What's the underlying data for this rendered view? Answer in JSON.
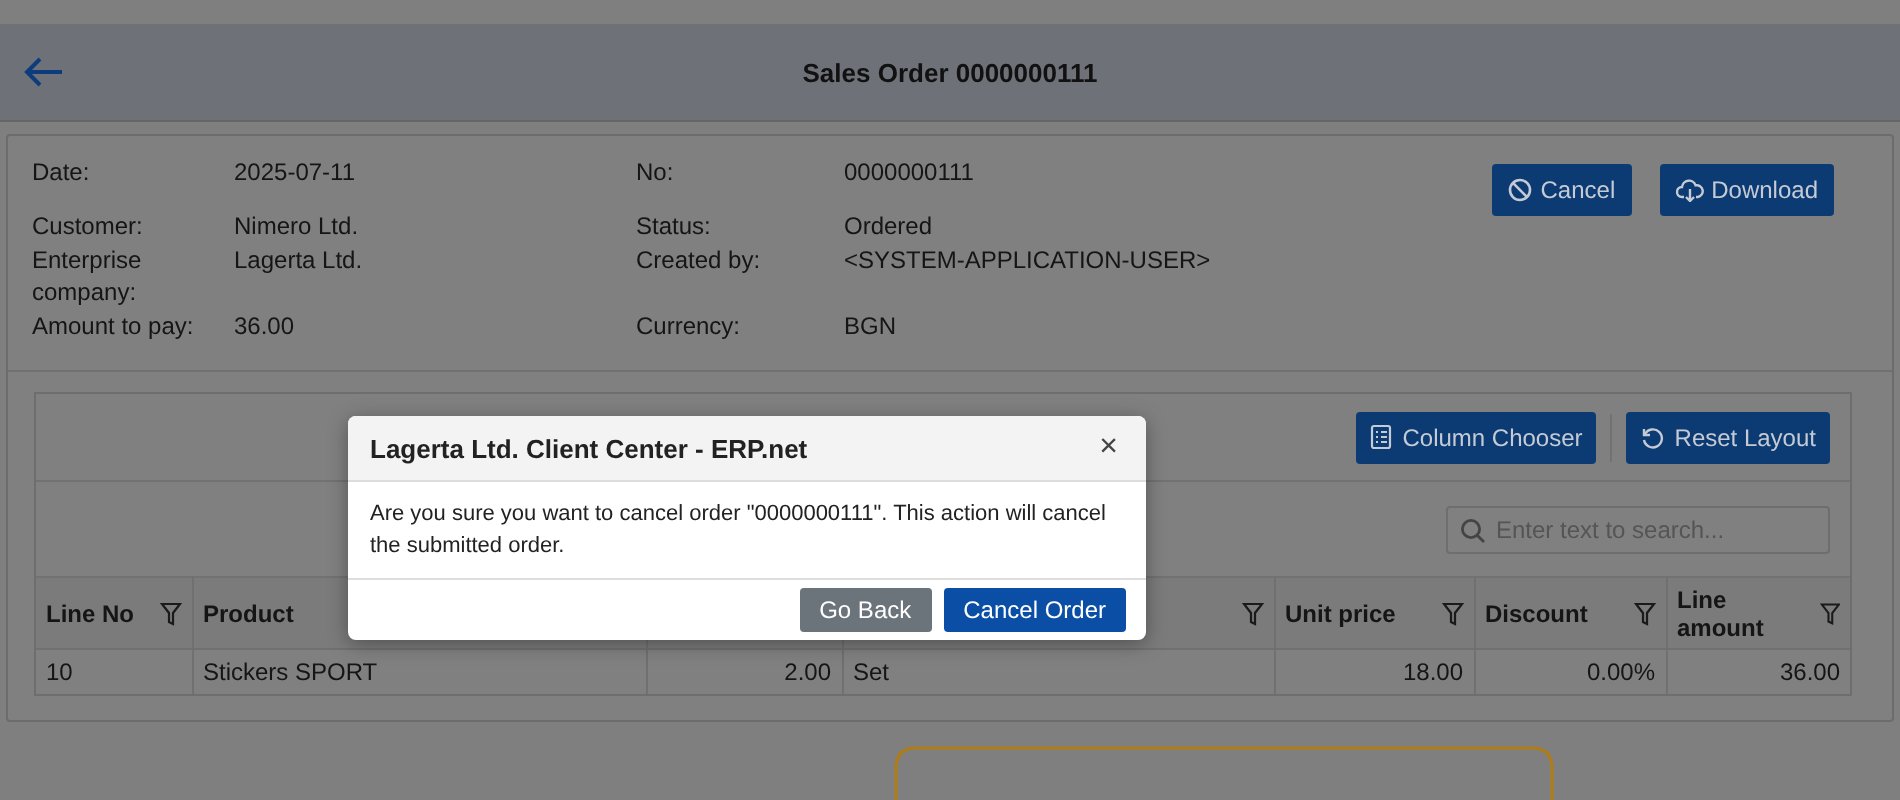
{
  "header": {
    "title": "Sales Order 0000000111"
  },
  "details": {
    "fields": [
      {
        "label": "Date:",
        "value": "2025-07-11"
      },
      {
        "label": "No:",
        "value": "0000000111"
      },
      {
        "label": "Customer:",
        "value": "Nimero Ltd."
      },
      {
        "label": "Status:",
        "value": "Ordered"
      },
      {
        "label": "Enterprise company:",
        "value": "Lagerta Ltd."
      },
      {
        "label": "Created by:",
        "value": "<SYSTEM-APPLICATION-USER>"
      },
      {
        "label": "Amount to pay:",
        "value": "36.00"
      },
      {
        "label": "Currency:",
        "value": "BGN"
      }
    ],
    "buttons": [
      {
        "kind": "cancel",
        "label": "Cancel"
      },
      {
        "kind": "download",
        "label": "Download"
      }
    ]
  },
  "grid": {
    "toolbar": [
      {
        "kind": "columns",
        "label": "Column Chooser"
      },
      {
        "kind": "reset",
        "label": "Reset Layout"
      }
    ],
    "search": {
      "placeholder": "Enter text to search..."
    },
    "columns": [
      {
        "label": "Line No",
        "filter": true,
        "numeric": false
      },
      {
        "label": "Product",
        "filter": false,
        "numeric": false
      },
      {
        "filter": false,
        "numeric": true
      },
      {
        "filter": true,
        "numeric": false
      },
      {
        "label": "Unit price",
        "filter": true,
        "numeric": true
      },
      {
        "label": "Discount",
        "filter": true,
        "numeric": true
      },
      {
        "label": "Line amount",
        "filter": true,
        "numeric": true
      }
    ],
    "rows": [
      [
        "10",
        "Stickers SPORT",
        "2.00",
        "Set",
        "18.00",
        "0.00%",
        "36.00"
      ]
    ]
  },
  "dialog": {
    "title": "Lagerta Ltd. Client Center - ERP.net",
    "close": "×",
    "message": "Are you sure you want to cancel order \"0000000111\". This action will cancel the submitted order.",
    "buttons": [
      {
        "kind": "secondary",
        "label": "Go Back"
      },
      {
        "kind": "primary",
        "label": "Cancel Order"
      }
    ]
  }
}
